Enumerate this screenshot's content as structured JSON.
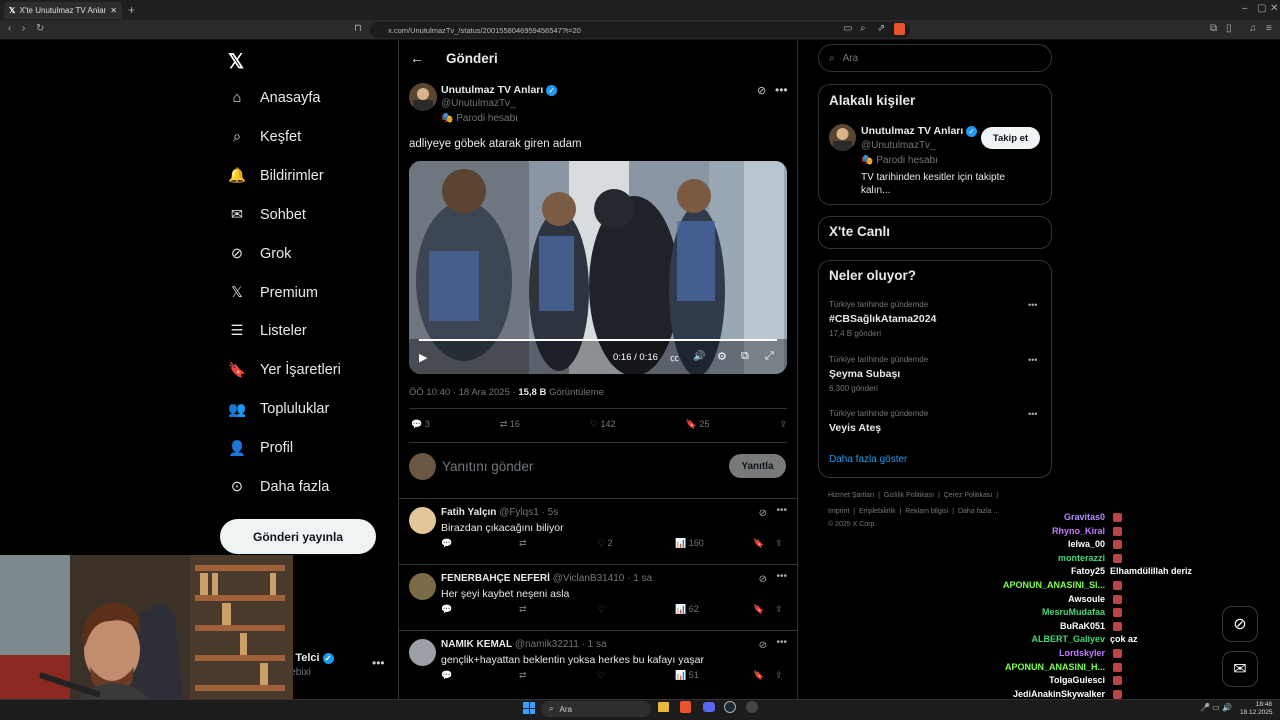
{
  "browser": {
    "tab_title": "X'te Unutulmaz TV Anları: \"adliy...",
    "url": "x.com/UnutulmazTv_/status/2001558046959456547?t=20"
  },
  "sidebar": {
    "items": [
      {
        "label": "Anasayfa",
        "icon": "home-icon"
      },
      {
        "label": "Keşfet",
        "icon": "search-icon"
      },
      {
        "label": "Bildirimler",
        "icon": "bell-icon"
      },
      {
        "label": "Sohbet",
        "icon": "mail-icon"
      },
      {
        "label": "Grok",
        "icon": "grok-icon"
      },
      {
        "label": "Premium",
        "icon": "x-icon"
      },
      {
        "label": "Listeler",
        "icon": "list-icon"
      },
      {
        "label": "Yer İşaretleri",
        "icon": "bookmark-icon"
      },
      {
        "label": "Topluluklar",
        "icon": "people-icon"
      },
      {
        "label": "Profil",
        "icon": "person-icon"
      },
      {
        "label": "Daha fazla",
        "icon": "more-circle-icon"
      }
    ],
    "post_button": "Gönderi yayınla",
    "account_name": "r Telci",
    "account_handle": "lebixi"
  },
  "main": {
    "header": "Gönderi",
    "post": {
      "author": "Unutulmaz TV Anları",
      "handle": "@UnutulmazTv_",
      "parody": "Parodi hesabı",
      "text": "adliyeye göbek atarak giren adam",
      "video_time": "0:16 / 0:16",
      "video_progress": 1.0,
      "time": "ÖÖ 10:40 · 18 Ara 2025 · ",
      "views": "15,8 B",
      "views_label": " Görüntüleme",
      "replies": "3",
      "retweets": "16",
      "likes": "142",
      "bookmarks": "25"
    },
    "compose": {
      "placeholder": "Yanıtını gönder",
      "button": "Yanıtla"
    },
    "replies": [
      {
        "name": "Fatih Yalçın",
        "handle": "@Fylqs1",
        "time": "· 5s",
        "text": "Birazdan çıkacağını biliyor",
        "retweets": "",
        "likes": "2",
        "views": "160"
      },
      {
        "name": "FENERBAHÇE NEFERİ",
        "handle": "@ViclanB31410",
        "time": "· 1 sa",
        "text": "Her şeyi kaybet neşeni asla",
        "retweets": "",
        "likes": "",
        "views": "62"
      },
      {
        "name": "NAMIK KEMAL",
        "handle": "@namik32211",
        "time": "· 1 sa",
        "text": "gençlik+hayattan  beklentin yoksa  herkes bu kafayı yaşar",
        "retweets": "",
        "likes": "",
        "views": "51"
      }
    ]
  },
  "right": {
    "search_placeholder": "Ara",
    "related_title": "Alakalı kişiler",
    "related": {
      "name": "Unutulmaz TV Anları",
      "handle": "@UnutulmazTv_",
      "parody": "Parodi hesabı",
      "bio": "TV tarihinden kesitler için takipte kalın...",
      "follow": "Takip et"
    },
    "live_title": "X'te Canlı",
    "trends_title": "Neler oluyor?",
    "trends": [
      {
        "context": "Türkiye tarihinde gündemde",
        "title": "#CBSağlıkAtama2024",
        "count": "17,4 B gönderi"
      },
      {
        "context": "Türkiye tarihinde gündemde",
        "title": "Şeyma Subaşı",
        "count": "6.300 gönderi"
      },
      {
        "context": "Türkiye tarihinde gündemde",
        "title": "Veyis Ateş",
        "count": ""
      }
    ],
    "show_more": "Daha fazla göster",
    "footer_line1": [
      "Hizmet Şartları",
      "Gizlilik Politikası",
      "Çerez Politikası"
    ],
    "footer_line2": [
      "Imprint",
      "Erişilebilirlik",
      "Reklam bilgisi",
      "Daha fazla ..."
    ],
    "copyright": "© 2025 X Corp."
  },
  "chat": [
    {
      "user": "Gravitas0",
      "color": "#b48cff",
      "msg": ""
    },
    {
      "user": "Rhyno_Kiral",
      "color": "#c07cff",
      "msg": ""
    },
    {
      "user": "lelwa_00",
      "color": "#ffffff",
      "msg": ""
    },
    {
      "user": "monterazzi",
      "color": "#3fd97a",
      "msg": ""
    },
    {
      "user": "Fatoy25",
      "color": "#ffffff",
      "msg": "Elhamdülillah deriz"
    },
    {
      "user": "APONUN_ANASINI_SI...",
      "color": "#7dff4d",
      "msg": ""
    },
    {
      "user": "Awsoule",
      "color": "#ffffff",
      "msg": ""
    },
    {
      "user": "MesruMudafaa",
      "color": "#3fd97a",
      "msg": ""
    },
    {
      "user": "BuRaK051",
      "color": "#ffffff",
      "msg": ""
    },
    {
      "user": "ALBERT_Galiyev",
      "color": "#3fd97a",
      "msg": "çok az"
    },
    {
      "user": "Lordskyler",
      "color": "#c07cff",
      "msg": ""
    },
    {
      "user": "APONUN_ANASINI_H...",
      "color": "#7dff4d",
      "msg": ""
    },
    {
      "user": "TolgaGulesci",
      "color": "#ffffff",
      "msg": ""
    },
    {
      "user": "JediAnakinSkywalker",
      "color": "#ffffff",
      "msg": ""
    }
  ],
  "taskbar": {
    "search": "Ara",
    "time": "18:48",
    "date": "18.12.2025"
  }
}
